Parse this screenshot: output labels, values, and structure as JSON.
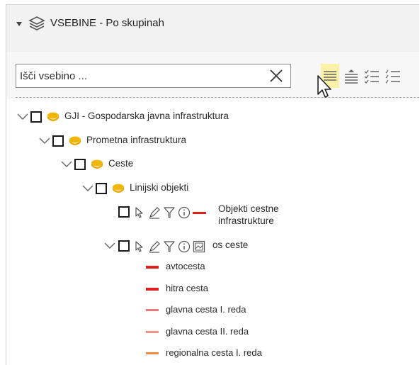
{
  "panel": {
    "title": "VSEBINE - Po skupinah"
  },
  "search": {
    "placeholder": "Išči vsebino ..."
  },
  "toolbar": {
    "icons": [
      "list-collapse-icon",
      "list-expand-icon",
      "checklist-icon",
      "checklist-alt-icon"
    ],
    "active": "list-collapse-icon",
    "highlight_color": "#fbf1a6"
  },
  "tree": {
    "gji": "GJI - Gospodarska javna infrastruktura",
    "prometna": "Prometna infrastruktura",
    "ceste": "Ceste",
    "linijski": "Linijski objekti",
    "objekti_line1": "Objekti cestne",
    "objekti_line2": "infrastrukture",
    "os_ceste": "os ceste"
  },
  "legend": [
    {
      "label": "avtocesta",
      "color": "#e02020"
    },
    {
      "label": "hitra cesta",
      "color": "#e02020"
    },
    {
      "label": "glavna cesta I. reda",
      "color": "#f07a7a"
    },
    {
      "label": "glavna cesta II. reda",
      "color": "#f4908a"
    },
    {
      "label": "regionalna cesta I. reda",
      "color": "#f08a3c"
    }
  ],
  "colors": {
    "folder": "#f2b705",
    "objekti_swatch": "#e02020"
  }
}
